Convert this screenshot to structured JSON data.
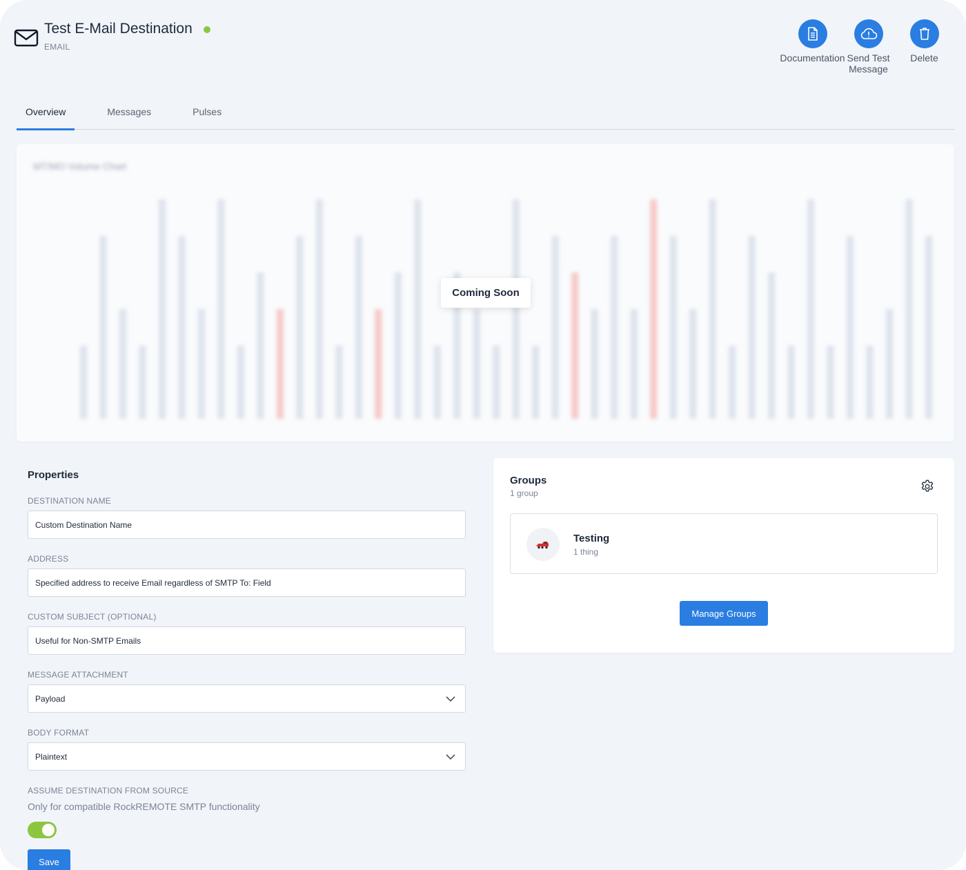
{
  "header": {
    "title": "Test E-Mail Destination",
    "subtitle": "EMAIL",
    "status_color": "#8cc63f",
    "actions": [
      {
        "label": "Documentation",
        "icon": "document-icon"
      },
      {
        "label": "Send Test Message",
        "icon": "cloud-alert-icon"
      },
      {
        "label": "Delete",
        "icon": "trash-icon"
      }
    ]
  },
  "tabs": [
    {
      "label": "Overview",
      "active": true
    },
    {
      "label": "Messages",
      "active": false
    },
    {
      "label": "Pulses",
      "active": false
    }
  ],
  "chart": {
    "title": "MT/MO Volume Chart",
    "overlay": "Coming Soon",
    "chart_data": {
      "type": "bar",
      "values": [
        2,
        5,
        3,
        2,
        6,
        5,
        3,
        6,
        2,
        4,
        3,
        5,
        6,
        2,
        5,
        3,
        4,
        6,
        2,
        4,
        3,
        2,
        6,
        2,
        5,
        4,
        3,
        5,
        3,
        6,
        5,
        3,
        6,
        2,
        5,
        4,
        2,
        6,
        2,
        5,
        2,
        3,
        6,
        5
      ],
      "highlight_indices": [
        10,
        15,
        25,
        29
      ],
      "colors": {
        "normal": "#dde3ec",
        "highlight": "#f6c9c7"
      }
    }
  },
  "properties": {
    "title": "Properties",
    "fields": [
      {
        "label": "DESTINATION NAME",
        "value": "Custom Destination Name"
      },
      {
        "label": "ADDRESS",
        "value": "Specified address to receive Email regardless of SMTP To: Field"
      },
      {
        "label": "CUSTOM SUBJECT (OPTIONAL)",
        "value": "Useful for Non-SMTP Emails"
      }
    ],
    "selects": [
      {
        "label": "MESSAGE ATTACHMENT",
        "value": "Payload"
      },
      {
        "label": "BODY FORMAT",
        "value": "Plaintext"
      }
    ],
    "assume": {
      "label": "ASSUME DESTINATION FROM SOURCE",
      "help": "Only for compatible RockREMOTE SMTP functionality",
      "enabled": true
    },
    "save_label": "Save"
  },
  "groups": {
    "title": "Groups",
    "count": "1 group",
    "items": [
      {
        "name": "Testing",
        "sub": "1 thing",
        "icon": "train-icon"
      }
    ],
    "manage_label": "Manage Groups"
  },
  "colors": {
    "accent": "#2a7de1",
    "status": "#8cc63f",
    "background": "#f1f4f9"
  }
}
